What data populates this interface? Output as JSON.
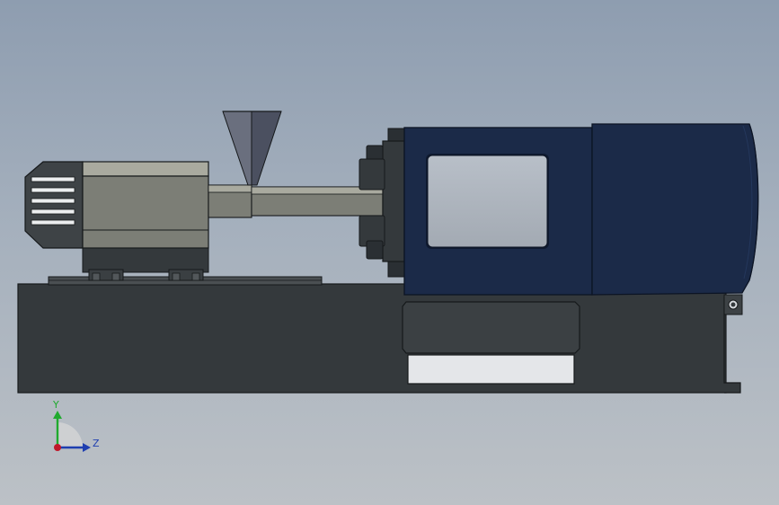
{
  "view": {
    "background_top": "#8e9db0",
    "background_bottom": "#bcc1c6"
  },
  "model": {
    "colors": {
      "base": "#34393c",
      "base_edge": "#1a1d1f",
      "injection_unit": "#7c7e76",
      "injection_unit_top": "#a9aa9f",
      "hopper": "#5a5f6e",
      "clamp_blue": "#1b2a48",
      "clamp_edge": "#0c1424",
      "window_fill": "#a4acb6"
    }
  },
  "triad": {
    "y_label": "Y",
    "z_label": "Z",
    "y_color": "#1faa2e",
    "z_color": "#1f3fb0",
    "origin_color": "#c0182a"
  }
}
